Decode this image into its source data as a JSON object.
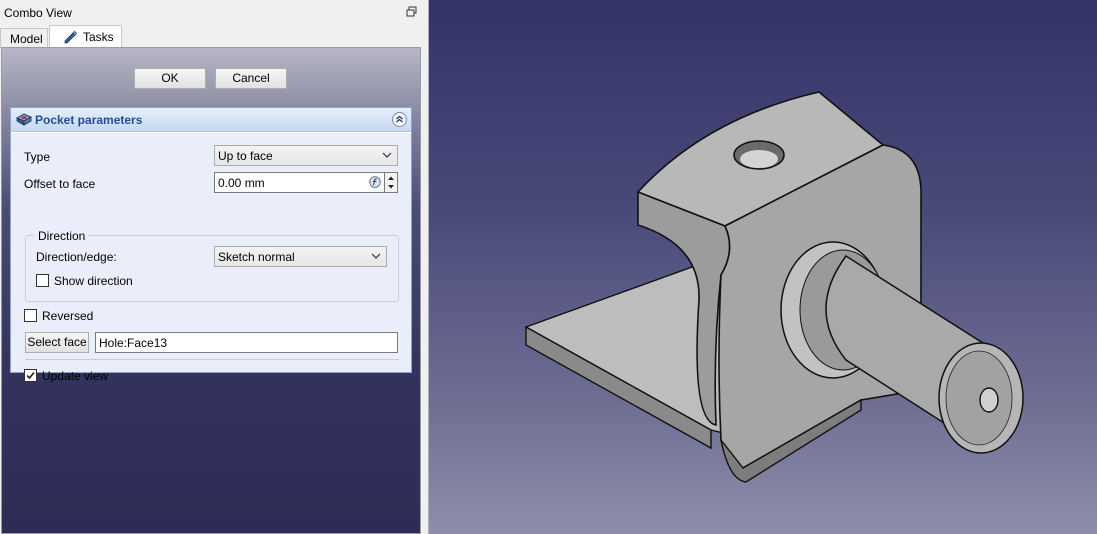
{
  "combo_view": {
    "title": "Combo View",
    "tabs": [
      {
        "label": "Model"
      },
      {
        "label": "Tasks"
      }
    ]
  },
  "task_buttons": {
    "ok": "OK",
    "cancel": "Cancel"
  },
  "pocket": {
    "title": "Pocket parameters",
    "type_label": "Type",
    "type_value": "Up to face",
    "offset_label": "Offset to face",
    "offset_value": "0.00 mm",
    "direction_group": "Direction",
    "direction_edge_label": "Direction/edge:",
    "direction_edge_value": "Sketch normal",
    "show_direction_label": "Show direction",
    "show_direction_checked": false,
    "reversed_label": "Reversed",
    "reversed_checked": false,
    "select_face_button": "Select face",
    "face_value": "Hole:Face13",
    "update_view_label": "Update view",
    "update_view_checked": true
  },
  "icons": {
    "float_button": "float-window-icon",
    "tasks_tab": "pencil-icon",
    "pocket": "pocket-feature-icon",
    "collapse": "chevron-double-up-icon",
    "expression": "expression-f-icon"
  },
  "colors": {
    "header_text": "#1f4e9b",
    "viewport_top": "#333366",
    "viewport_bottom": "#8e8eaa",
    "model_gray": "#a6a6a6"
  }
}
